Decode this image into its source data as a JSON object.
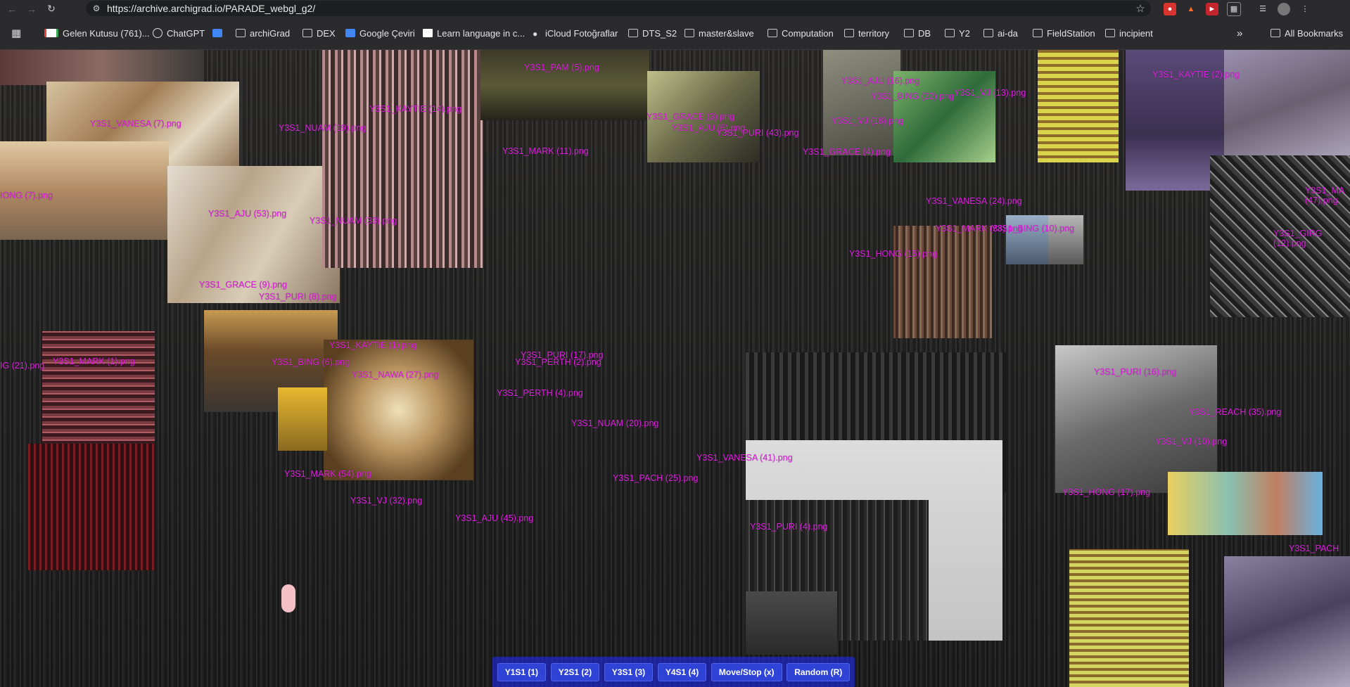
{
  "browser": {
    "url": "https://archive.archigrad.io/PARADE_webgl_g2/",
    "bookmarks": [
      "Gelen Kutusu (761)...",
      "ChatGPT",
      "archiGrad",
      "DEX",
      "Google Çeviri",
      "Learn language in c...",
      "iCloud Fotoğraflar",
      "DTS_S2",
      "master&slave",
      "Computation",
      "territory",
      "DB",
      "Y2",
      "ai-da",
      "FieldStation",
      "incipient"
    ],
    "more_bookmarks": "»",
    "all_bookmarks": "All Bookmarks"
  },
  "image_labels": [
    "Y3S1_PAM (5).png",
    "Y3S1_KAYTIE (14).png",
    "Y3S1_VANESA (7).png",
    "Y3S1_NUAM (19).png",
    "Y3S1_MARK (11).png",
    "Y3S1_GRACE (3).png",
    "Y3S1_AJU (6).png",
    "Y3S1_PURI (43).png",
    "Y3S1_AJU (16).png",
    "Y3S1_BING (22).png",
    "Y3S1_VJ (13).png",
    "Y3S1_KAYTIE (2).png",
    "Y3S1_VJ (18).png",
    "Y3S1_GRACE (4).png",
    "IONG (7).png",
    "Y3S1_AJU (53).png",
    "Y3S1_NUAM (33).png",
    "Y3S1_VANESA (24).png",
    "Y3S1_MARK (38).png",
    "Y3S1_BING (10).png",
    "Y3S1_MA (47).png",
    "Y3S1_GIRG (12).png",
    "Y3S1_HONG (15).png",
    "Y3S1_GRACE (9).png",
    "Y3S1_PURI (8).png",
    "Y3S1_KAYTIE (1).png",
    "Y3S1_BING (6).png",
    "Y3S1_MARK (1).png",
    "IG (21).png",
    "Y3S1_PURI (17).png",
    "Y3S1_PERTH (2).png",
    "Y3S1_NAWA (27).png",
    "Y3S1_PERTH (4).png",
    "Y3S1_PURI (16).png",
    "Y3S1_NUAM (20).png",
    "Y3S1_REACH (35).png",
    "Y3S1_VANESA (41).png",
    "Y3S1_VJ (10).png",
    "Y3S1_MARK (54).png",
    "Y3S1_PACH (25).png",
    "Y3S1_VJ (32).png",
    "Y3S1_AJU (45).png",
    "Y3S1_PURI (4).png",
    "Y3S1_HONG (17).png",
    "Y3S1_PACH"
  ],
  "controls": {
    "y1s1": "Y1S1 (1)",
    "y2s1": "Y2S1 (2)",
    "y3s1": "Y3S1 (3)",
    "y4s1": "Y4S1 (4)",
    "move": "Move/Stop (x)",
    "random": "Random (R)"
  },
  "colors": {
    "label": "#e020e0",
    "button_bar": "#1e28dc",
    "chrome": "#2b2b2d"
  },
  "icons": [
    "back-icon",
    "forward-icon",
    "reload-icon",
    "site-settings-icon",
    "star-icon",
    "apps-grid-icon",
    "folder-icon",
    "gmail-icon",
    "chatgpt-icon",
    "translate-icon",
    "apple-icon"
  ]
}
